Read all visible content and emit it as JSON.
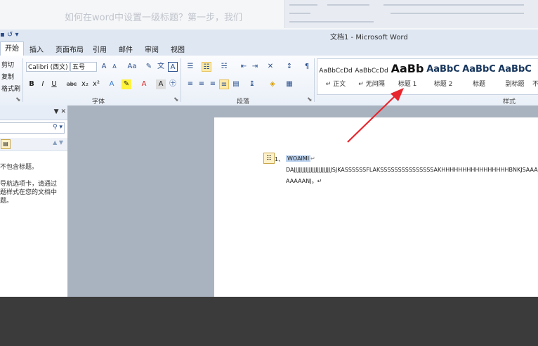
{
  "background": {
    "article_title": "如何在word中设置一级标题？第一步，我们"
  },
  "window": {
    "quick_access": "▪ ↺ ▾",
    "title": "文档1 - Microsoft Word"
  },
  "tabs": [
    {
      "label": "开始",
      "active": true
    },
    {
      "label": "插入"
    },
    {
      "label": "页面布局"
    },
    {
      "label": "引用"
    },
    {
      "label": "邮件"
    },
    {
      "label": "审阅"
    },
    {
      "label": "视图"
    }
  ],
  "clipboard": {
    "cut": "剪切",
    "copy": "复制",
    "format_painter": "格式刷"
  },
  "font": {
    "family": "Calibri (西文)",
    "size": "五号",
    "group_label": "字体"
  },
  "paragraph": {
    "group_label": "段落"
  },
  "styles": {
    "group_label": "样式",
    "items": [
      {
        "preview": "AaBbCcDd",
        "name": "↵ 正文"
      },
      {
        "preview": "AaBbCcDd",
        "name": "↵ 无间隔"
      },
      {
        "preview": "AaBb",
        "name": "标题 1"
      },
      {
        "preview": "AaBbC",
        "name": "标题 2"
      },
      {
        "preview": "AaBbC",
        "name": "标题"
      },
      {
        "preview": "AaBbC",
        "name": "副标题"
      },
      {
        "preview": "",
        "name": "不"
      }
    ]
  },
  "nav_pane": {
    "close": "▼ ✕",
    "msg1": "不包含标题。",
    "msg2_line1": "导航选项卡，请通过",
    "msg2_line2": "题样式在您的文档中",
    "msg2_line3": "题。"
  },
  "document": {
    "list_number": "1、",
    "heading": "WOAIMI",
    "pilcrow": "↵",
    "line1": "DAJJJJJJJJJJJJJJJJJJJJJJJSJKASSSSSSFLAKSSSSSSSSSSSSSSSAKHHHHHHHHHHHHHHHHBNKJSAAA",
    "line2": "AAAAANJ。↵"
  },
  "colors": {
    "arrow": "#e8262e",
    "ribbon_accent": "#2a4f8f",
    "selection": "#b9d1ee"
  }
}
